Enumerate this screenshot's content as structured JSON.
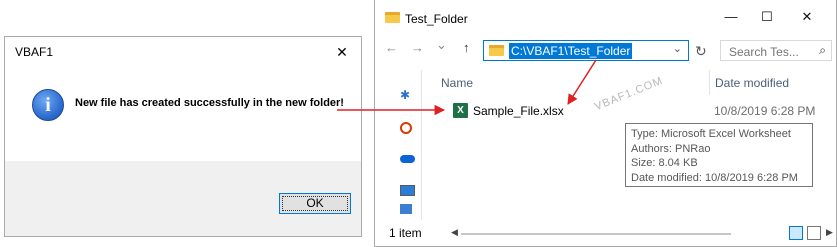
{
  "msgbox": {
    "title": "VBAF1",
    "close": "✕",
    "icon": "info-icon",
    "icon_glyph": "i",
    "message": "New file has created successfully in the new folder!",
    "ok_label": "OK"
  },
  "explorer": {
    "title": "Test_Folder",
    "controls": {
      "minimize": "—",
      "maximize": "☐",
      "close": "✕"
    },
    "nav": {
      "back": "←",
      "forward": "→",
      "recent": "⌄",
      "up": "↑"
    },
    "address": "C:\\VBAF1\\Test_Folder",
    "address_chevron": "⌄",
    "refresh": "↻",
    "search": {
      "placeholder": "Search Tes...",
      "icon": "⌕"
    },
    "columns": {
      "name": "Name",
      "date": "Date modified"
    },
    "file": {
      "icon": "X",
      "name": "Sample_File.xlsx",
      "date": "10/8/2019 6:28 PM"
    },
    "watermark": "VBAF1.COM",
    "tooltip": {
      "type": "Type: Microsoft Excel Worksheet",
      "authors": "Authors: PNRao",
      "size": "Size: 8.04 KB",
      "date": "Date modified: 10/8/2019 6:28 PM"
    },
    "scroll": {
      "left": "◀",
      "right": "▶"
    },
    "status": "1 item"
  },
  "colors": {
    "accent": "#0078d7",
    "arrow": "#e02020",
    "excel_green": "#1e7145",
    "folder_yellow": "#f7c948"
  }
}
